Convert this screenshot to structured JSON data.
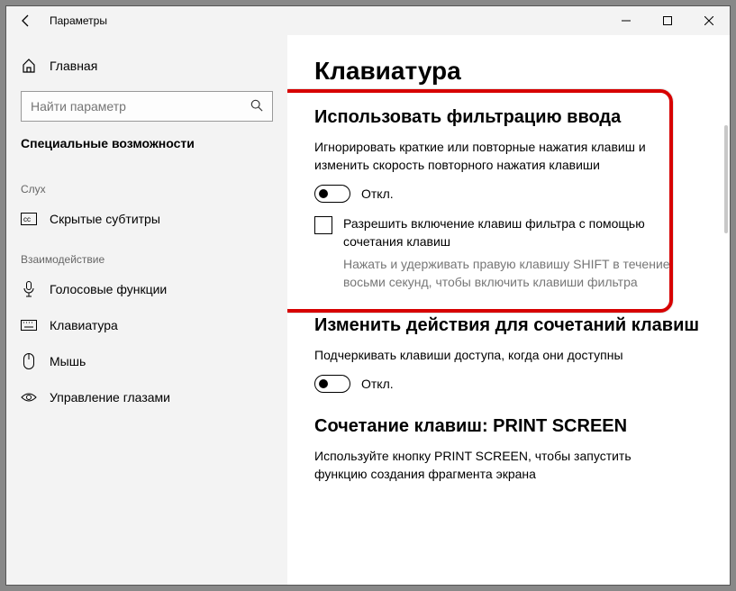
{
  "app_title": "Параметры",
  "sidebar": {
    "home_label": "Главная",
    "search_placeholder": "Найти параметр",
    "category_title": "Специальные возможности",
    "groups": [
      {
        "label": "Слух",
        "items": [
          {
            "id": "captions",
            "label": "Скрытые субтитры"
          }
        ]
      },
      {
        "label": "Взаимодействие",
        "items": [
          {
            "id": "speech",
            "label": "Голосовые функции"
          },
          {
            "id": "keyboard",
            "label": "Клавиатура"
          },
          {
            "id": "mouse",
            "label": "Мышь"
          },
          {
            "id": "eye",
            "label": "Управление глазами"
          }
        ]
      }
    ]
  },
  "page": {
    "title": "Клавиатура",
    "filter": {
      "heading": "Использовать фильтрацию ввода",
      "desc": "Игнорировать краткие или повторные нажатия клавиш и изменить скорость повторного нажатия клавиши",
      "toggle_state": "Откл.",
      "checkbox_label": "Разрешить включение клавиш фильтра с помощью сочетания клавиш",
      "checkbox_hint": "Нажать и удерживать правую клавишу SHIFT в течение восьми секунд, чтобы включить клавиши фильтра"
    },
    "shortcut": {
      "heading": "Изменить действия для сочетаний клавиш",
      "desc": "Подчеркивать клавиши доступа, когда они доступны",
      "toggle_state": "Откл."
    },
    "printscreen": {
      "heading": "Сочетание клавиш: PRINT SCREEN",
      "desc": "Используйте кнопку PRINT SCREEN, чтобы запустить функцию создания фрагмента экрана"
    }
  }
}
